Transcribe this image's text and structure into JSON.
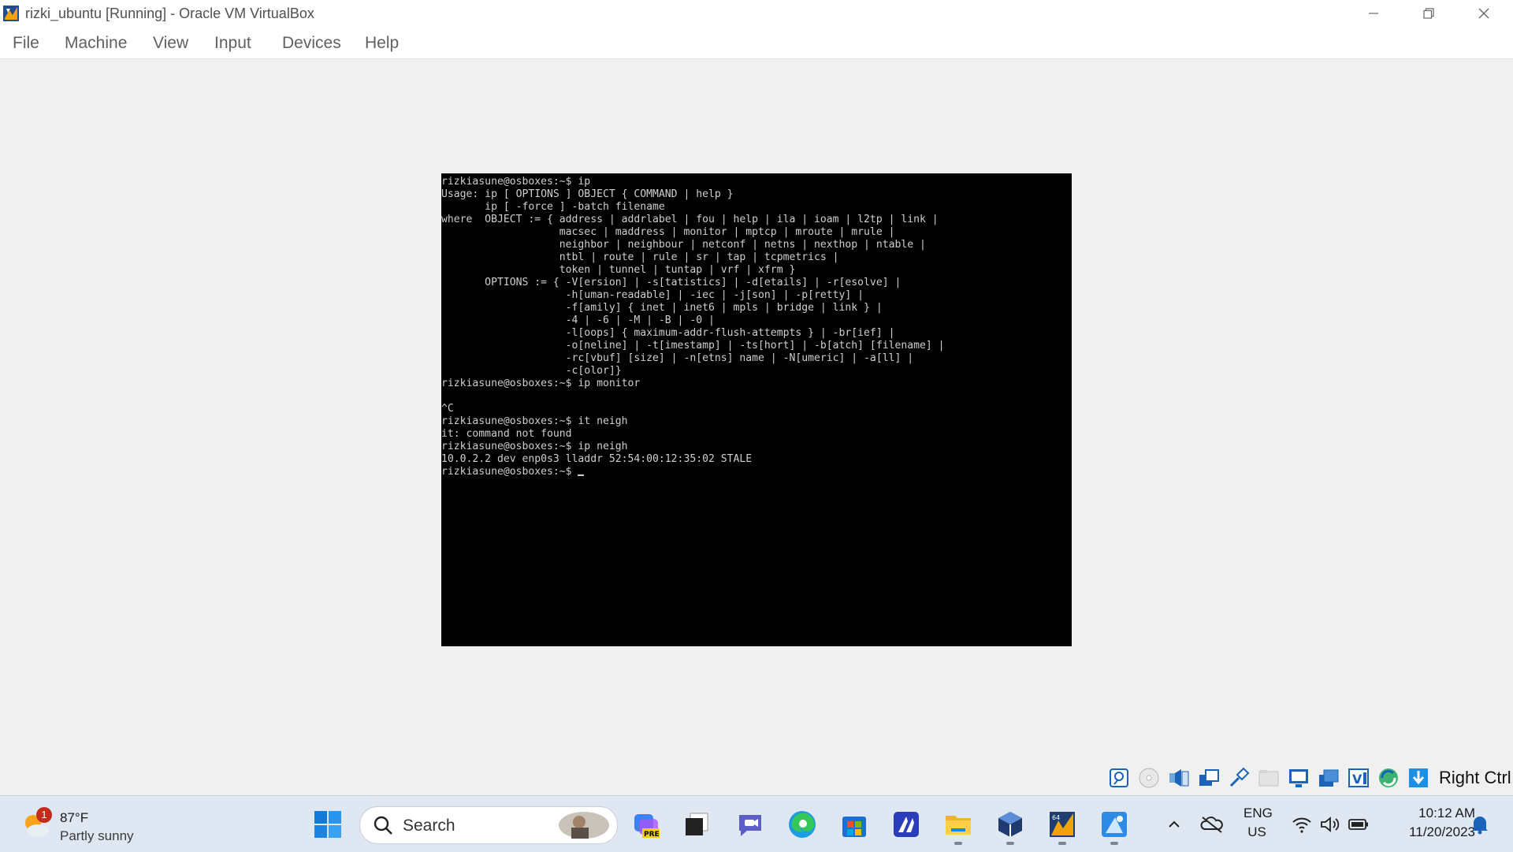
{
  "window": {
    "title": "rizki_ubuntu [Running] - Oracle VM VirtualBox"
  },
  "menu": [
    "File",
    "Machine",
    "View",
    "Input",
    "Devices",
    "Help"
  ],
  "console": {
    "lines": [
      "rizkiasune@osboxes:~$ ip",
      "Usage: ip [ OPTIONS ] OBJECT { COMMAND | help }",
      "       ip [ -force ] -batch filename",
      "where  OBJECT := { address | addrlabel | fou | help | ila | ioam | l2tp | link |",
      "                   macsec | maddress | monitor | mptcp | mroute | mrule |",
      "                   neighbor | neighbour | netconf | netns | nexthop | ntable |",
      "                   ntbl | route | rule | sr | tap | tcpmetrics |",
      "                   token | tunnel | tuntap | vrf | xfrm }",
      "       OPTIONS := { -V[ersion] | -s[tatistics] | -d[etails] | -r[esolve] |",
      "                    -h[uman-readable] | -iec | -j[son] | -p[retty] |",
      "                    -f[amily] { inet | inet6 | mpls | bridge | link } |",
      "                    -4 | -6 | -M | -B | -0 |",
      "                    -l[oops] { maximum-addr-flush-attempts } | -br[ief] |",
      "                    -o[neline] | -t[imestamp] | -ts[hort] | -b[atch] [filename] |",
      "                    -rc[vbuf] [size] | -n[etns] name | -N[umeric] | -a[ll] |",
      "                    -c[olor]}",
      "rizkiasune@osboxes:~$ ip monitor",
      "",
      "^C",
      "rizkiasune@osboxes:~$ it neigh",
      "it: command not found",
      "rizkiasune@osboxes:~$ ip neigh",
      "10.0.2.2 dev enp0s3 lladdr 52:54:00:12:35:02 STALE"
    ],
    "prompt": "rizkiasune@osboxes:~$ "
  },
  "statusbar": {
    "host_key": "Right Ctrl",
    "icons": [
      "hard-disk-icon",
      "optical-drive-icon",
      "audio-icon",
      "network-icon",
      "usb-icon",
      "shared-folders-icon",
      "display-icon",
      "recording-icon",
      "guest-additions-icon",
      "mouse-integration-icon",
      "keyboard-capture-icon"
    ]
  },
  "taskbar": {
    "weather": {
      "badge": "1",
      "temp": "87°F",
      "condition": "Partly sunny"
    },
    "search_label": "Search",
    "language": "ENG",
    "region": "US",
    "time": "10:12 AM",
    "date": "11/20/2023"
  },
  "colors": {
    "console_bg": "#000000",
    "console_text": "#cfcfcf",
    "taskbar_bg": "#dfe7f2",
    "accent": "#0067c0"
  }
}
